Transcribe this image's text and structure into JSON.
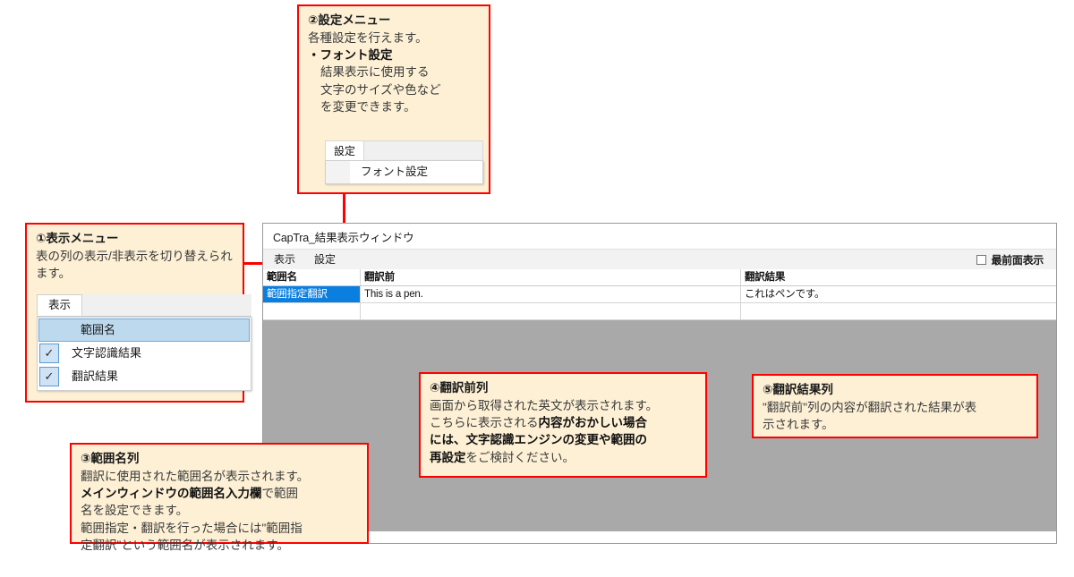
{
  "callouts": {
    "view_menu": {
      "title": "①表示メニュー",
      "body": "表の列の表示/非表示を切り替えられます。",
      "widget": {
        "tab_label": "表示",
        "items": [
          {
            "label": "範囲名",
            "checked": false,
            "highlighted": true
          },
          {
            "label": "文字認識結果",
            "checked": true,
            "highlighted": false
          },
          {
            "label": "翻訳結果",
            "checked": true,
            "highlighted": false
          }
        ],
        "check_glyph": "✓"
      }
    },
    "settings_menu": {
      "title": "②設定メニュー",
      "line1": "各種設定を行えます。",
      "line2": "・フォント設定",
      "line3": "結果表示に使用する",
      "line4": "文字のサイズや色など",
      "line5": "を変更できます。",
      "widget": {
        "tab_label": "設定",
        "item_label": "フォント設定"
      }
    },
    "range_name_col": {
      "title": "③範囲名列",
      "line1": "翻訳に使用された範囲名が表示されます。",
      "bold1": "メインウィンドウの範囲名入力欄",
      "tail1": "で範囲",
      "line2": "名を設定できます。",
      "line3": "範囲指定・翻訳を行った場合には\"範囲指",
      "line4": "定翻訳\"という範囲名が表示されます。"
    },
    "source_col": {
      "title": "④翻訳前列",
      "line1": "画面から取得された英文が表示されます。",
      "line2_pre": "こちらに表示される",
      "line2_bold": "内容がおかしい場合",
      "line3_bold": "には、文字認識エンジンの変更や範囲の",
      "line4_bold": "再設定",
      "line4_tail": "をご検討ください。"
    },
    "result_col": {
      "title": "⑤翻訳結果列",
      "line1": "\"翻訳前\"列の内容が翻訳された結果が表",
      "line2": "示されます。"
    }
  },
  "window": {
    "title": "CapTra_結果表示ウィンドウ",
    "menus": [
      "表示",
      "設定"
    ],
    "topmost_label": "最前面表示",
    "topmost_checked": false,
    "grid": {
      "columns": [
        "範囲名",
        "翻訳前",
        "翻訳結果"
      ],
      "rows": [
        {
          "range_name": "範囲指定翻訳",
          "source": "This is a pen.",
          "result": "これはペンです。",
          "selected": true
        },
        {
          "range_name": "",
          "source": "",
          "result": "",
          "selected": false
        }
      ]
    }
  },
  "colors": {
    "callout_bg": "#FDF0D5",
    "callout_border": "#FF0000",
    "selection_blue": "#0A7FE0",
    "window_body_gray": "#A9A9A9"
  }
}
